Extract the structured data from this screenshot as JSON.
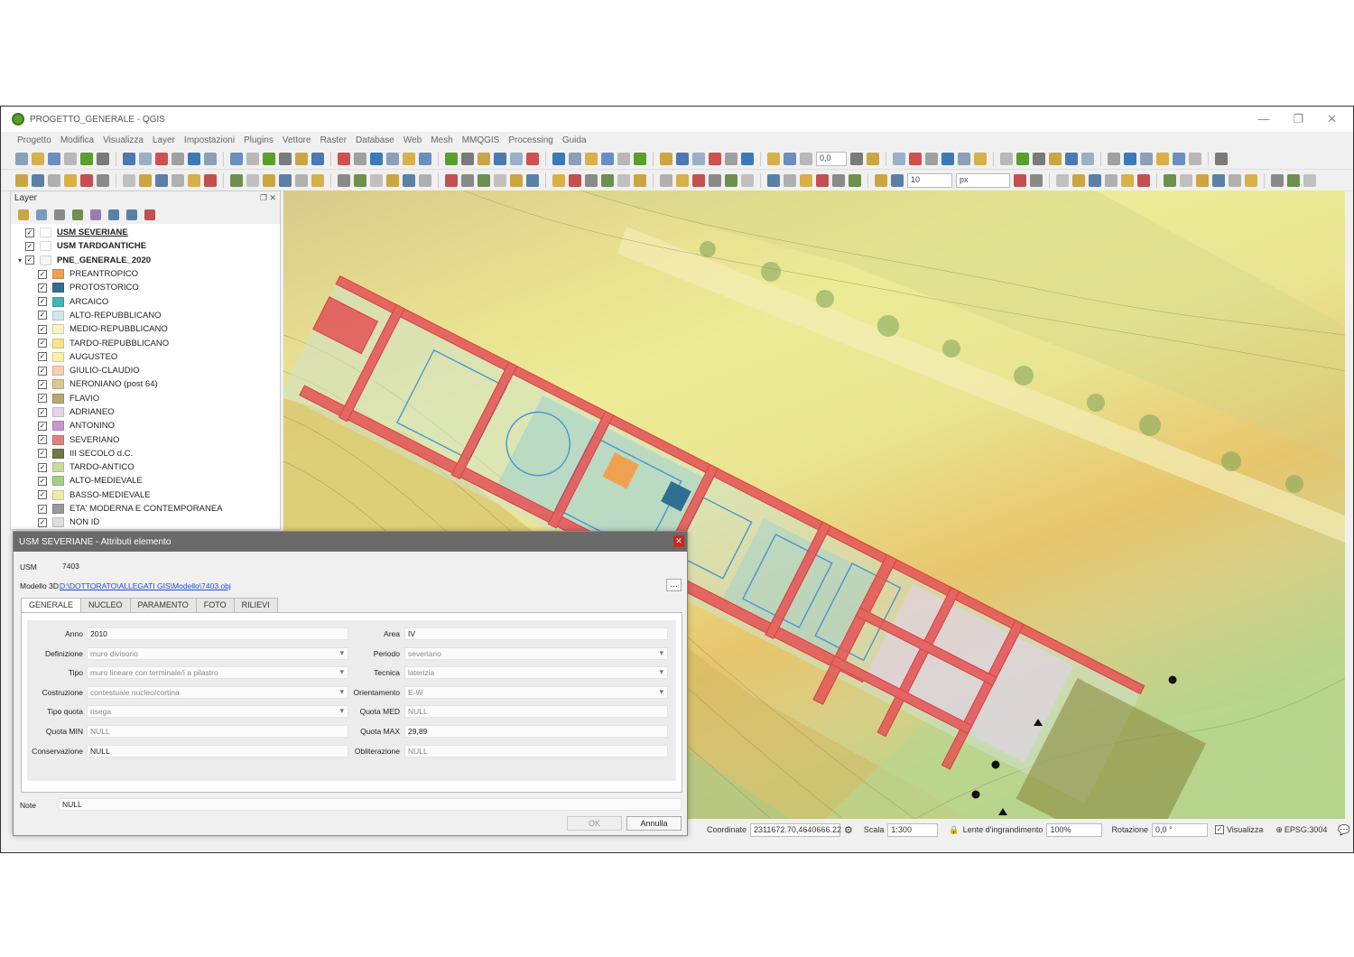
{
  "window": {
    "title": "PROGETTO_GENERALE - QGIS"
  },
  "menu": [
    "Progetto",
    "Modifica",
    "Visualizza",
    "Layer",
    "Impostazioni",
    "Plugins",
    "Vettore",
    "Raster",
    "Database",
    "Web",
    "Mesh",
    "MMQGIS",
    "Processing",
    "Guida"
  ],
  "toolbar": {
    "coord_field": "0,0",
    "size_field": "10",
    "unit_field": "px"
  },
  "layers_panel": {
    "title": "Layer",
    "layers": [
      {
        "label": "USM SEVERIANE",
        "level": 0,
        "checked": true,
        "swatch": "#ffffff",
        "bold": true,
        "underline": true
      },
      {
        "label": "USM TARDOANTICHE",
        "level": 0,
        "checked": true,
        "swatch": "#ffffff",
        "bold": true
      },
      {
        "label": "PNE_GENERALE_2020",
        "level": 0,
        "checked": true,
        "group": true,
        "bold": true
      },
      {
        "label": "PREANTROPICO",
        "level": 1,
        "checked": true,
        "swatch": "#f0a050"
      },
      {
        "label": "PROTOSTORICO",
        "level": 1,
        "checked": true,
        "swatch": "#2f6f8f"
      },
      {
        "label": "ARCAICO",
        "level": 1,
        "checked": true,
        "swatch": "#3fb5b5"
      },
      {
        "label": "ALTO-REPUBBLICANO",
        "level": 1,
        "checked": true,
        "swatch": "#cfe8ec"
      },
      {
        "label": "MEDIO-REPUBBLICANO",
        "level": 1,
        "checked": true,
        "swatch": "#f6f4c4"
      },
      {
        "label": "TARDO-REPUBBLICANO",
        "level": 1,
        "checked": true,
        "swatch": "#f6e38a"
      },
      {
        "label": "AUGUSTEO",
        "level": 1,
        "checked": true,
        "swatch": "#f8efaa"
      },
      {
        "label": "GIULIO-CLAUDIO",
        "level": 1,
        "checked": true,
        "swatch": "#f5d0b0"
      },
      {
        "label": "NERONIANO (post 64)",
        "level": 1,
        "checked": true,
        "swatch": "#d8c890"
      },
      {
        "label": "FLAVIO",
        "level": 1,
        "checked": true,
        "swatch": "#b8a870"
      },
      {
        "label": "ADRIANEO",
        "level": 1,
        "checked": true,
        "swatch": "#e2d4ef"
      },
      {
        "label": "ANTONINO",
        "level": 1,
        "checked": true,
        "swatch": "#c797cc"
      },
      {
        "label": "SEVERIANO",
        "level": 1,
        "checked": true,
        "swatch": "#e38080"
      },
      {
        "label": "III SECOLO d.C.",
        "level": 1,
        "checked": true,
        "swatch": "#6d7a44"
      },
      {
        "label": "TARDO-ANTICO",
        "level": 1,
        "checked": true,
        "swatch": "#c9dca0"
      },
      {
        "label": "ALTO-MEDIEVALE",
        "level": 1,
        "checked": true,
        "swatch": "#a6cf86"
      },
      {
        "label": "BASSO-MEDIEVALE",
        "level": 1,
        "checked": true,
        "swatch": "#eeeaa8"
      },
      {
        "label": "ETA' MODERNA E CONTEMPORANEA",
        "level": 1,
        "checked": true,
        "swatch": "#9a9a9a"
      },
      {
        "label": "NON ID",
        "level": 1,
        "checked": true,
        "swatch": "#dddddd"
      }
    ]
  },
  "dialog": {
    "title": "USM SEVERIANE - Attributi elemento",
    "usm_label": "USM",
    "usm_value": "7403",
    "model_label": "Modello 3D",
    "model_link": "D:\\DOTTORATO\\ALLEGATI GIS\\Modello\\7403.obj",
    "tabs": [
      "GENERALE",
      "NUCLEO",
      "PARAMENTO",
      "FOTO",
      "RILIEVI"
    ],
    "left_fields": [
      {
        "label": "Anno",
        "value": "2010",
        "combo": false,
        "grey": false
      },
      {
        "label": "Definizione",
        "value": "muro divisorio",
        "combo": true,
        "grey": true
      },
      {
        "label": "Tipo",
        "value": "muro lineare con terminale/i a pilastro",
        "combo": true,
        "grey": true
      },
      {
        "label": "Costruzione",
        "value": "contestuale nucleo/cortina",
        "combo": true,
        "grey": true
      },
      {
        "label": "Tipo quota",
        "value": "risega",
        "combo": true,
        "grey": true
      },
      {
        "label": "Quota MIN",
        "value": "NULL",
        "combo": false,
        "grey": true
      },
      {
        "label": "Conservazione",
        "value": "NULL",
        "combo": false,
        "grey": false
      }
    ],
    "right_fields": [
      {
        "label": "Area",
        "value": "IV",
        "combo": false,
        "grey": false
      },
      {
        "label": "Periodo",
        "value": "severiano",
        "combo": true,
        "grey": true
      },
      {
        "label": "Tecnica",
        "value": "laterizia",
        "combo": true,
        "grey": true
      },
      {
        "label": "Orientamento",
        "value": "E-W",
        "combo": true,
        "grey": true
      },
      {
        "label": "Quota MED",
        "value": "NULL",
        "combo": false,
        "grey": true
      },
      {
        "label": "Quota MAX",
        "value": "29,89",
        "combo": false,
        "grey": false
      },
      {
        "label": "Obliterazione",
        "value": "NULL",
        "combo": false,
        "grey": true
      }
    ],
    "note_label": "Note",
    "note_value": "NULL",
    "ok_label": "OK",
    "cancel_label": "Annulla"
  },
  "statusbar": {
    "coord_label": "Coordinate",
    "coord_value": "2311672.70,4640666.22",
    "scale_label": "Scala",
    "scale_value": "1:300",
    "magnifier_label": "Lente d'ingrandimento",
    "magnifier_value": "100%",
    "rotation_label": "Rotazione",
    "rotation_value": "0,0 °",
    "render_label": "Visualizza",
    "crs_label": "EPSG:3004"
  }
}
